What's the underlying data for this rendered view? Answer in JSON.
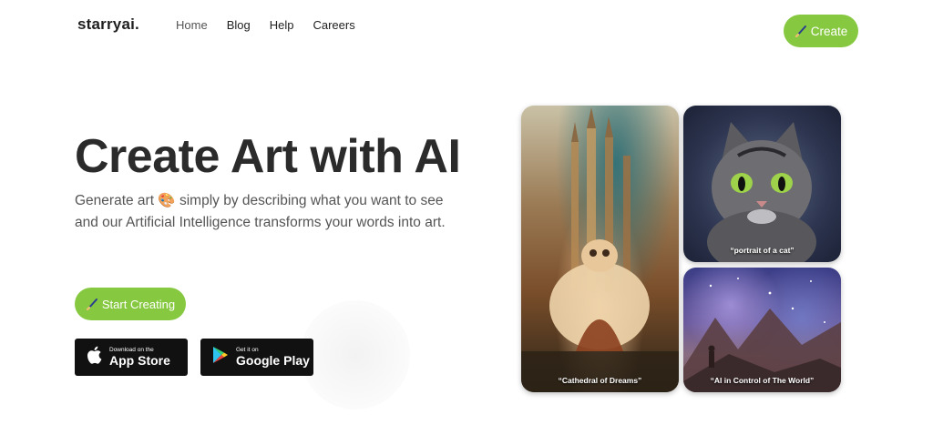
{
  "brand": {
    "name": "starryai",
    "dot": ".",
    "accent": "#86c940"
  },
  "nav": {
    "items": [
      {
        "label": "Home"
      },
      {
        "label": "Blog"
      },
      {
        "label": "Help"
      },
      {
        "label": "Careers"
      }
    ]
  },
  "header": {
    "create_label": "Create",
    "create_icon": "paintbrush-icon"
  },
  "hero": {
    "title": "Create Art with AI",
    "subtitle_before": "Generate art",
    "subtitle_emoji": "🎨",
    "subtitle_after": "simply by describing what you want to see and our Artificial Intelligence transforms your words into art.",
    "cta_label": "Start Creating",
    "cta_icon": "paintbrush-icon"
  },
  "stores": {
    "apple": {
      "small": "Download on the",
      "big": "App Store",
      "icon": "apple-icon"
    },
    "google": {
      "small": "Get it on",
      "big": "Google Play",
      "icon": "google-play-icon"
    }
  },
  "gallery": {
    "items": [
      {
        "caption": "“Cathedral of Dreams”"
      },
      {
        "caption": "“portrait of a cat”"
      },
      {
        "caption": "“AI in Control of The World”"
      }
    ]
  }
}
